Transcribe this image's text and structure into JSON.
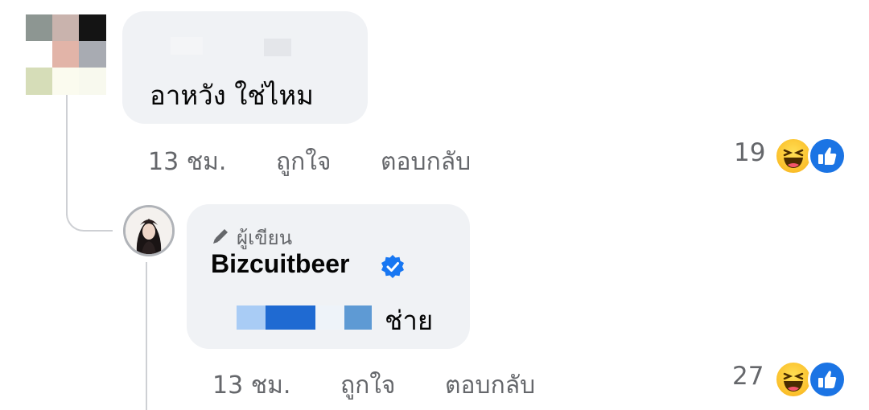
{
  "comment1": {
    "text": "อาหวัง ใช่ไหม",
    "time": "13 ชม.",
    "like_label": "ถูกใจ",
    "reply_label": "ตอบกลับ",
    "reaction_count": "19",
    "reactions": [
      "haha-icon",
      "like-icon"
    ]
  },
  "comment2": {
    "badge": "ผู้เขียน",
    "author": "Bizcuitbeer",
    "text": "ช่าย",
    "time": "13 ชม.",
    "like_label": "ถูกใจ",
    "reply_label": "ตอบกลับ",
    "reaction_count": "27",
    "reactions": [
      "haha-icon",
      "like-icon"
    ]
  },
  "colors": {
    "bubble": "#f0f2f5",
    "meta_text": "#65676b",
    "verified": "#1877f2",
    "like": "#1b74e4",
    "haha": "#fbbf2a"
  }
}
